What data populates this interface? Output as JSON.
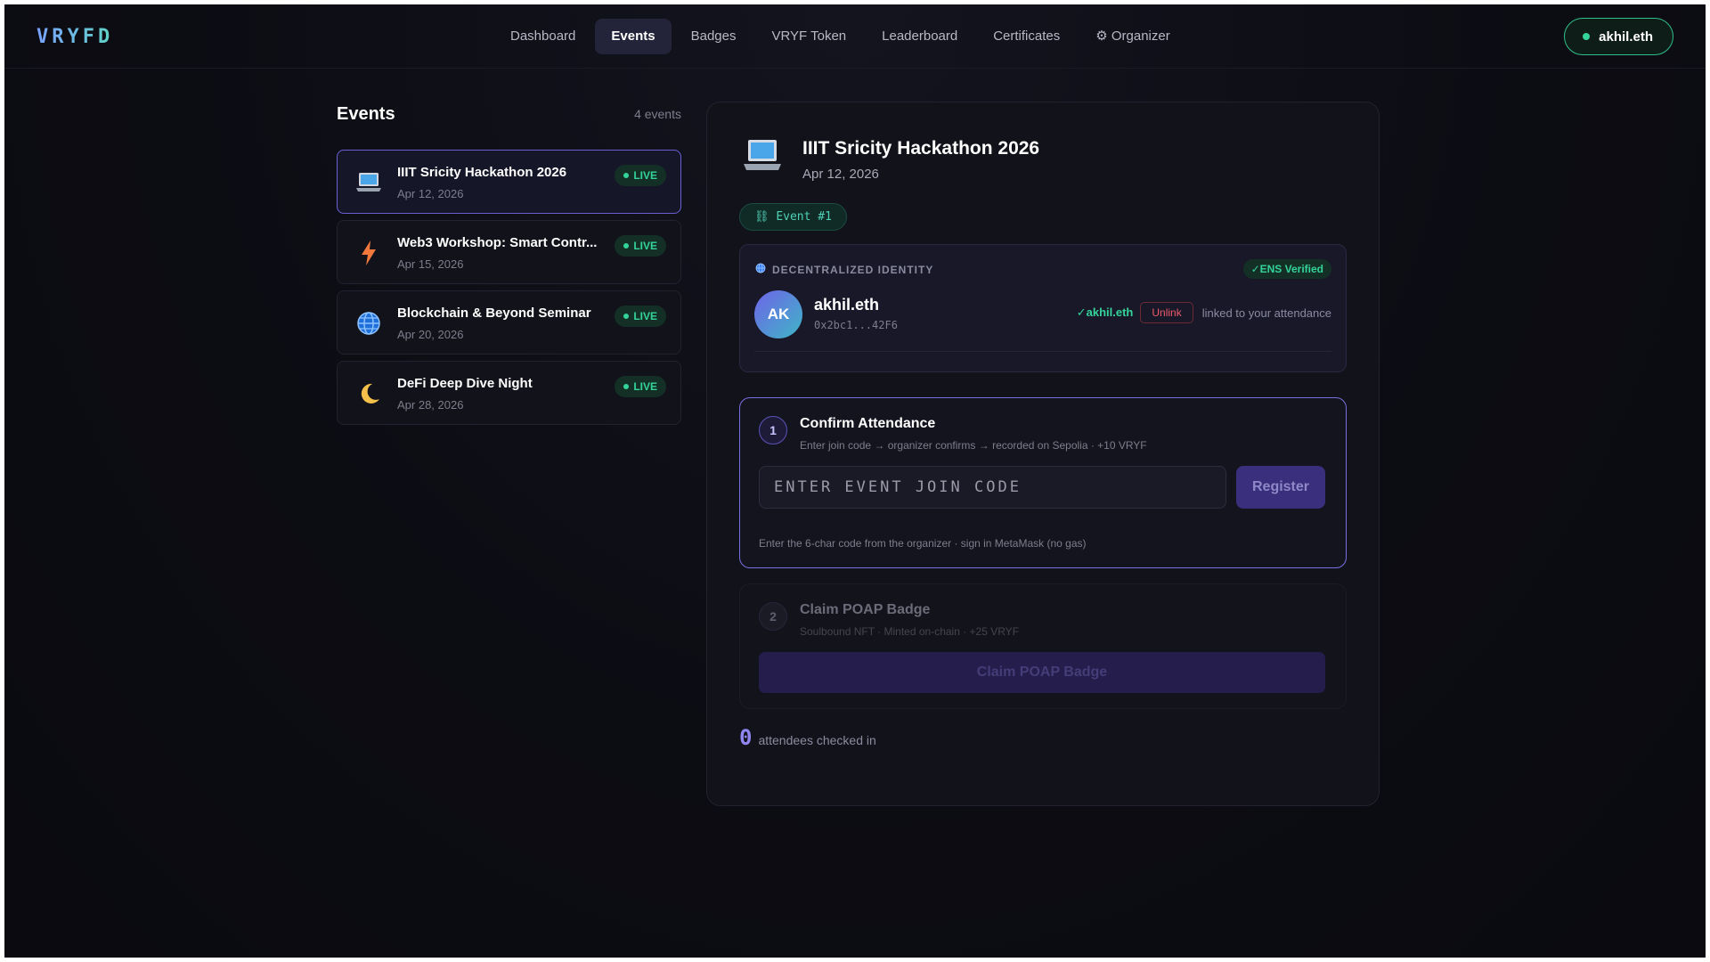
{
  "brand": "VRYFD",
  "nav": {
    "items": [
      {
        "label": "Dashboard"
      },
      {
        "label": "Events",
        "active": true
      },
      {
        "label": "Badges"
      },
      {
        "label": "VRYF Token"
      },
      {
        "label": "Leaderboard"
      },
      {
        "label": "Certificates"
      },
      {
        "label": "⚙ Organizer"
      }
    ]
  },
  "wallet": {
    "label": "akhil.eth",
    "status_color": "#34d399"
  },
  "sidebar": {
    "title": "Events",
    "count": "4 events",
    "items": [
      {
        "icon": "laptop-icon",
        "name": "IIIT Sricity Hackathon 2026",
        "date": "Apr 12, 2026",
        "status": "LIVE",
        "selected": true
      },
      {
        "icon": "lightning-icon",
        "name": "Web3 Workshop: Smart Contr...",
        "date": "Apr 15, 2026",
        "status": "LIVE"
      },
      {
        "icon": "globe-icon",
        "name": "Blockchain & Beyond Seminar",
        "date": "Apr 20, 2026",
        "status": "LIVE"
      },
      {
        "icon": "moon-icon",
        "name": "DeFi Deep Dive Night",
        "date": "Apr 28, 2026",
        "status": "LIVE"
      }
    ]
  },
  "detail": {
    "icon": "laptop-icon",
    "title": "IIIT Sricity Hackathon 2026",
    "date": "Apr 12, 2026",
    "chip": "⛓ Event #1",
    "identity": {
      "label": "DECENTRALIZED IDENTITY",
      "badge": "✓ENS Verified",
      "avatar_initials": "AK",
      "ens_name": "akhil.eth",
      "address": "0x2bc1...42F6",
      "linked_ens": "✓akhil.eth",
      "unlink_label": "Unlink",
      "linked_note": "linked to your attendance"
    },
    "step1": {
      "number": "1",
      "title": "Confirm Attendance",
      "subtitle": "Enter join code → organizer confirms → recorded on Sepolia · +10 VRYF",
      "input_placeholder": "ENTER EVENT JOIN CODE",
      "input_value": "",
      "button": "Register",
      "hint": "Enter the 6-char code from the organizer · sign in MetaMask (no gas)"
    },
    "step2": {
      "number": "2",
      "title": "Claim POAP Badge",
      "subtitle": "Soulbound NFT · Minted on-chain · +25 VRYF",
      "button": "Claim POAP Badge",
      "enabled": false
    },
    "attendees": {
      "count": "0",
      "label": "attendees checked in"
    }
  },
  "colors": {
    "accent": "#7a6fe0",
    "live_green": "#34d399",
    "danger": "#ef5b6b",
    "background": "#0c0c13"
  }
}
